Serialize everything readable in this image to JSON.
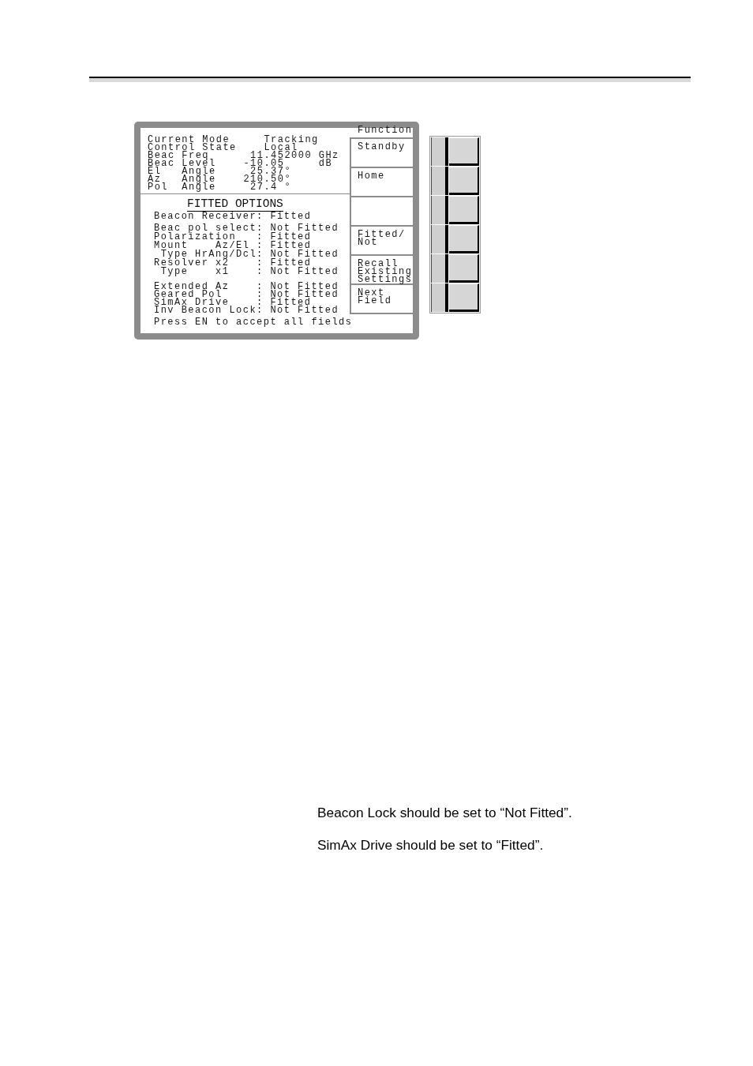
{
  "screen": {
    "status": [
      {
        "label": "Current Mode",
        "value": "Tracking",
        "kind": "state"
      },
      {
        "label": "Control State",
        "value": "Local",
        "kind": "state"
      },
      {
        "label": "Beac Freq",
        "value": "11.452000",
        "unit": "GHz",
        "kind": "reading"
      },
      {
        "label": "Beac Level",
        "value": "-10.05",
        "unit": "dB",
        "kind": "reading"
      },
      {
        "label": "El   Angle",
        "value": "25.37°",
        "kind": "reading"
      },
      {
        "label": "Az   Angle",
        "value": "210.50°",
        "kind": "reading"
      },
      {
        "label": "Pol  Angle",
        "value": "27.4 °",
        "kind": "reading"
      }
    ],
    "options_title": "FITTED OPTIONS",
    "option_groups": [
      [
        {
          "label": "Beacon Receiver:",
          "value": "Fitted"
        }
      ],
      [
        {
          "label": "Beac pol select:",
          "value": "Not Fitted"
        },
        {
          "label": "Polarization   :",
          "value": "Fitted"
        },
        {
          "label": "Mount    Az/El :",
          "value": "Fitted",
          "children": [
            {
              "label": "Type HrAng/Dcl:",
              "value": "Not Fitted"
            }
          ]
        },
        {
          "label": "Resolver x2    :",
          "value": "Fitted",
          "children": [
            {
              "label": "Type    x1    :",
              "value": "Not Fitted"
            }
          ]
        }
      ],
      [
        {
          "label": "Extended Az    :",
          "value": "Not Fitted"
        },
        {
          "label": "Geared Pol     :",
          "value": "Not Fitted"
        },
        {
          "label": "SimAx Drive    :",
          "value": "Fitted"
        },
        {
          "label": "Inv Beacon Lock:",
          "value": "Not Fitted"
        }
      ]
    ],
    "prompt": "Press EN to accept all fields",
    "softkey_heading": "Function",
    "softkeys": [
      {
        "kind": "key",
        "label": "Standby"
      },
      {
        "kind": "key",
        "label": "Home"
      },
      {
        "kind": "blank"
      },
      {
        "kind": "key",
        "label": "Fitted/\nNot"
      },
      {
        "kind": "key",
        "label": "Recall\nExisting\nSettings"
      },
      {
        "kind": "key",
        "label": "Next\nField"
      }
    ]
  },
  "notes": [
    "Beacon Lock should be set to “Not Fitted”.",
    "SimAx Drive should be set to “Fitted”."
  ]
}
